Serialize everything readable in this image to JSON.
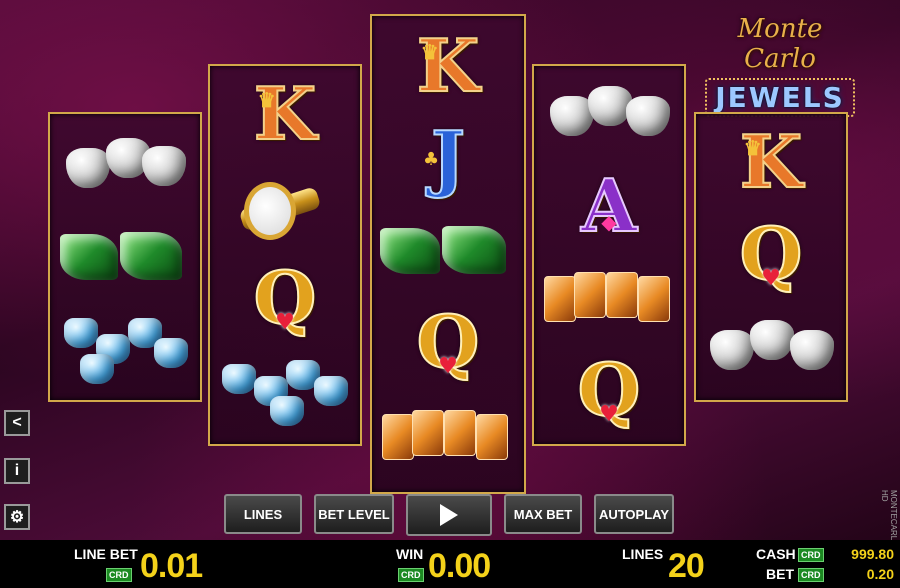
{
  "game": {
    "logo_top": "Monte Carlo",
    "logo_bottom": "JEWELS",
    "vertical_label": "MONTECARLOJEWELS HD"
  },
  "reels": {
    "r1": [
      "white-diamonds",
      "green-emeralds",
      "blue-diamonds"
    ],
    "r2": [
      "K",
      "gold-watch",
      "Q",
      "blue-diamonds"
    ],
    "r3": [
      "K",
      "J",
      "green-emeralds",
      "Q",
      "orange-gems"
    ],
    "r4": [
      "white-diamonds",
      "A",
      "orange-gems",
      "Q"
    ],
    "r5": [
      "K",
      "Q",
      "white-diamonds"
    ]
  },
  "buttons": {
    "lines": "LINES",
    "bet_level": "BET LEVEL",
    "play": "play-icon",
    "max_bet": "MAX BET",
    "autoplay": "AUTOPLAY"
  },
  "side_icons": [
    "share-icon",
    "info-icon",
    "settings-icon"
  ],
  "side_glyphs": {
    "share": "<",
    "info": "i",
    "settings": "⚙"
  },
  "status": {
    "line_bet_label": "LINE BET",
    "line_bet_value": "0.01",
    "win_label": "WIN",
    "win_value": "0.00",
    "lines_label": "LINES",
    "lines_value": "20",
    "cash_label": "CASH",
    "cash_value": "999.80",
    "bet_label": "BET",
    "bet_value": "0.20",
    "crd": "CRD"
  },
  "colors": {
    "accent_gold": "#f4d21a",
    "crd_green": "#1c8a22",
    "frame_gold": "#d2a84a"
  }
}
